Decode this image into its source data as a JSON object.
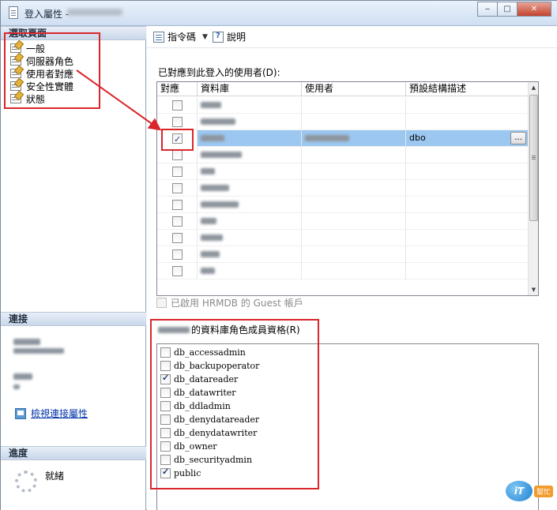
{
  "window": {
    "title": "登入屬性 - ",
    "minimize_glyph": "‒",
    "maximize_glyph": "□",
    "close_glyph": "✕"
  },
  "left": {
    "select_page_header": "選取頁面",
    "pages": [
      {
        "label": "一般",
        "icon": "page-icon"
      },
      {
        "label": "伺服器角色",
        "icon": "page-icon"
      },
      {
        "label": "使用者對應",
        "icon": "page-icon"
      },
      {
        "label": "安全性實體",
        "icon": "page-icon"
      },
      {
        "label": "狀態",
        "icon": "page-icon"
      }
    ],
    "connection_header": "連接",
    "view_connection_link": "檢視連接屬性",
    "progress_header": "進度",
    "progress_status": "就緒"
  },
  "toolbar": {
    "script_label": "指令碼",
    "help_label": "說明"
  },
  "users": {
    "label": "已對應到此登入的使用者(D):",
    "columns": [
      "對應",
      "資料庫",
      "使用者",
      "預設結構描述"
    ],
    "rows": [
      {
        "checked": false,
        "user": "",
        "schema": "",
        "selected": false
      },
      {
        "checked": false,
        "user": "",
        "schema": "",
        "selected": false
      },
      {
        "checked": true,
        "user": "",
        "schema": "dbo",
        "selected": true
      },
      {
        "checked": false,
        "user": "",
        "schema": "",
        "selected": false
      },
      {
        "checked": false,
        "user": "",
        "schema": "",
        "selected": false
      },
      {
        "checked": false,
        "user": "",
        "schema": "",
        "selected": false
      },
      {
        "checked": false,
        "user": "",
        "schema": "",
        "selected": false
      },
      {
        "checked": false,
        "user": "",
        "schema": "",
        "selected": false
      },
      {
        "checked": false,
        "user": "",
        "schema": "",
        "selected": false
      },
      {
        "checked": false,
        "user": "",
        "schema": "",
        "selected": false
      },
      {
        "checked": false,
        "user": "",
        "schema": "",
        "selected": false
      }
    ],
    "ellipsis_label": "..."
  },
  "guest": {
    "label": "已啟用 HRMDB 的 Guest 帳戶"
  },
  "roles": {
    "label": "的資料庫角色成員資格(R)",
    "items": [
      {
        "name": "db_accessadmin",
        "checked": false
      },
      {
        "name": "db_backupoperator",
        "checked": false
      },
      {
        "name": "db_datareader",
        "checked": true
      },
      {
        "name": "db_datawriter",
        "checked": false
      },
      {
        "name": "db_ddladmin",
        "checked": false
      },
      {
        "name": "db_denydatareader",
        "checked": false
      },
      {
        "name": "db_denydatawriter",
        "checked": false
      },
      {
        "name": "db_owner",
        "checked": false
      },
      {
        "name": "db_securityadmin",
        "checked": false
      },
      {
        "name": "public",
        "checked": true
      }
    ]
  },
  "watermark": {
    "logo_text": "iT",
    "tag_text": "幫忙"
  },
  "colors": {
    "annotation_red": "#d9262b",
    "selected_row": "#9cc7f0",
    "link_blue": "#0033a8"
  }
}
